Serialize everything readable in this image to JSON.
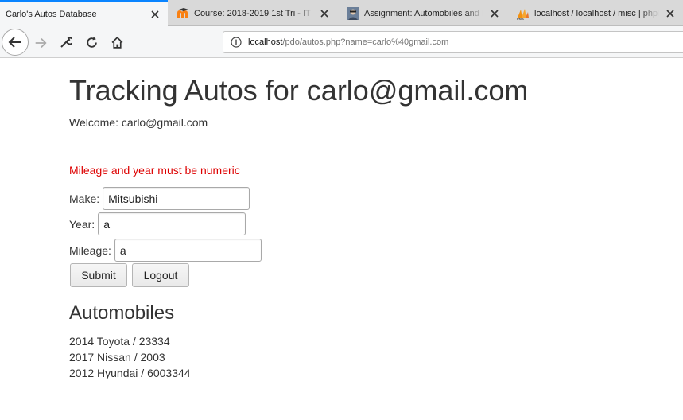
{
  "browser": {
    "tabs": [
      {
        "title": "Carlo's Autos Database",
        "active": true,
        "favicon": "none"
      },
      {
        "title": "Course: 2018-2019 1st Tri - IT S",
        "active": false,
        "favicon": "moodle-icon"
      },
      {
        "title": "Assignment: Automobiles and Da",
        "active": false,
        "favicon": "avatar-icon"
      },
      {
        "title": "localhost / localhost / misc | phpM",
        "active": false,
        "favicon": "phpmyadmin-icon"
      }
    ],
    "url": {
      "host": "localhost",
      "path": "/pdo/autos.php?name=carlo%40gmail.com"
    },
    "nav_icons": [
      "back-icon",
      "forward-icon",
      "wrench-icon",
      "reload-icon",
      "home-icon",
      "info-icon"
    ],
    "accent_color": "#0a84ff"
  },
  "page": {
    "title": "Tracking Autos for carlo@gmail.com",
    "welcome": "Welcome: carlo@gmail.com",
    "error": "Mileage and year must be numeric",
    "error_color": "#dd0000",
    "form": {
      "make_label": "Make:",
      "make_value": "Mitsubishi",
      "year_label": "Year:",
      "year_value": "a",
      "mileage_label": "Mileage:",
      "mileage_value": "a",
      "submit_label": "Submit",
      "logout_label": "Logout"
    },
    "automobiles_heading": "Automobiles",
    "automobiles": [
      "2014 Toyota / 23334",
      "2017 Nissan / 2003",
      "2012 Hyundai / 6003344"
    ]
  }
}
